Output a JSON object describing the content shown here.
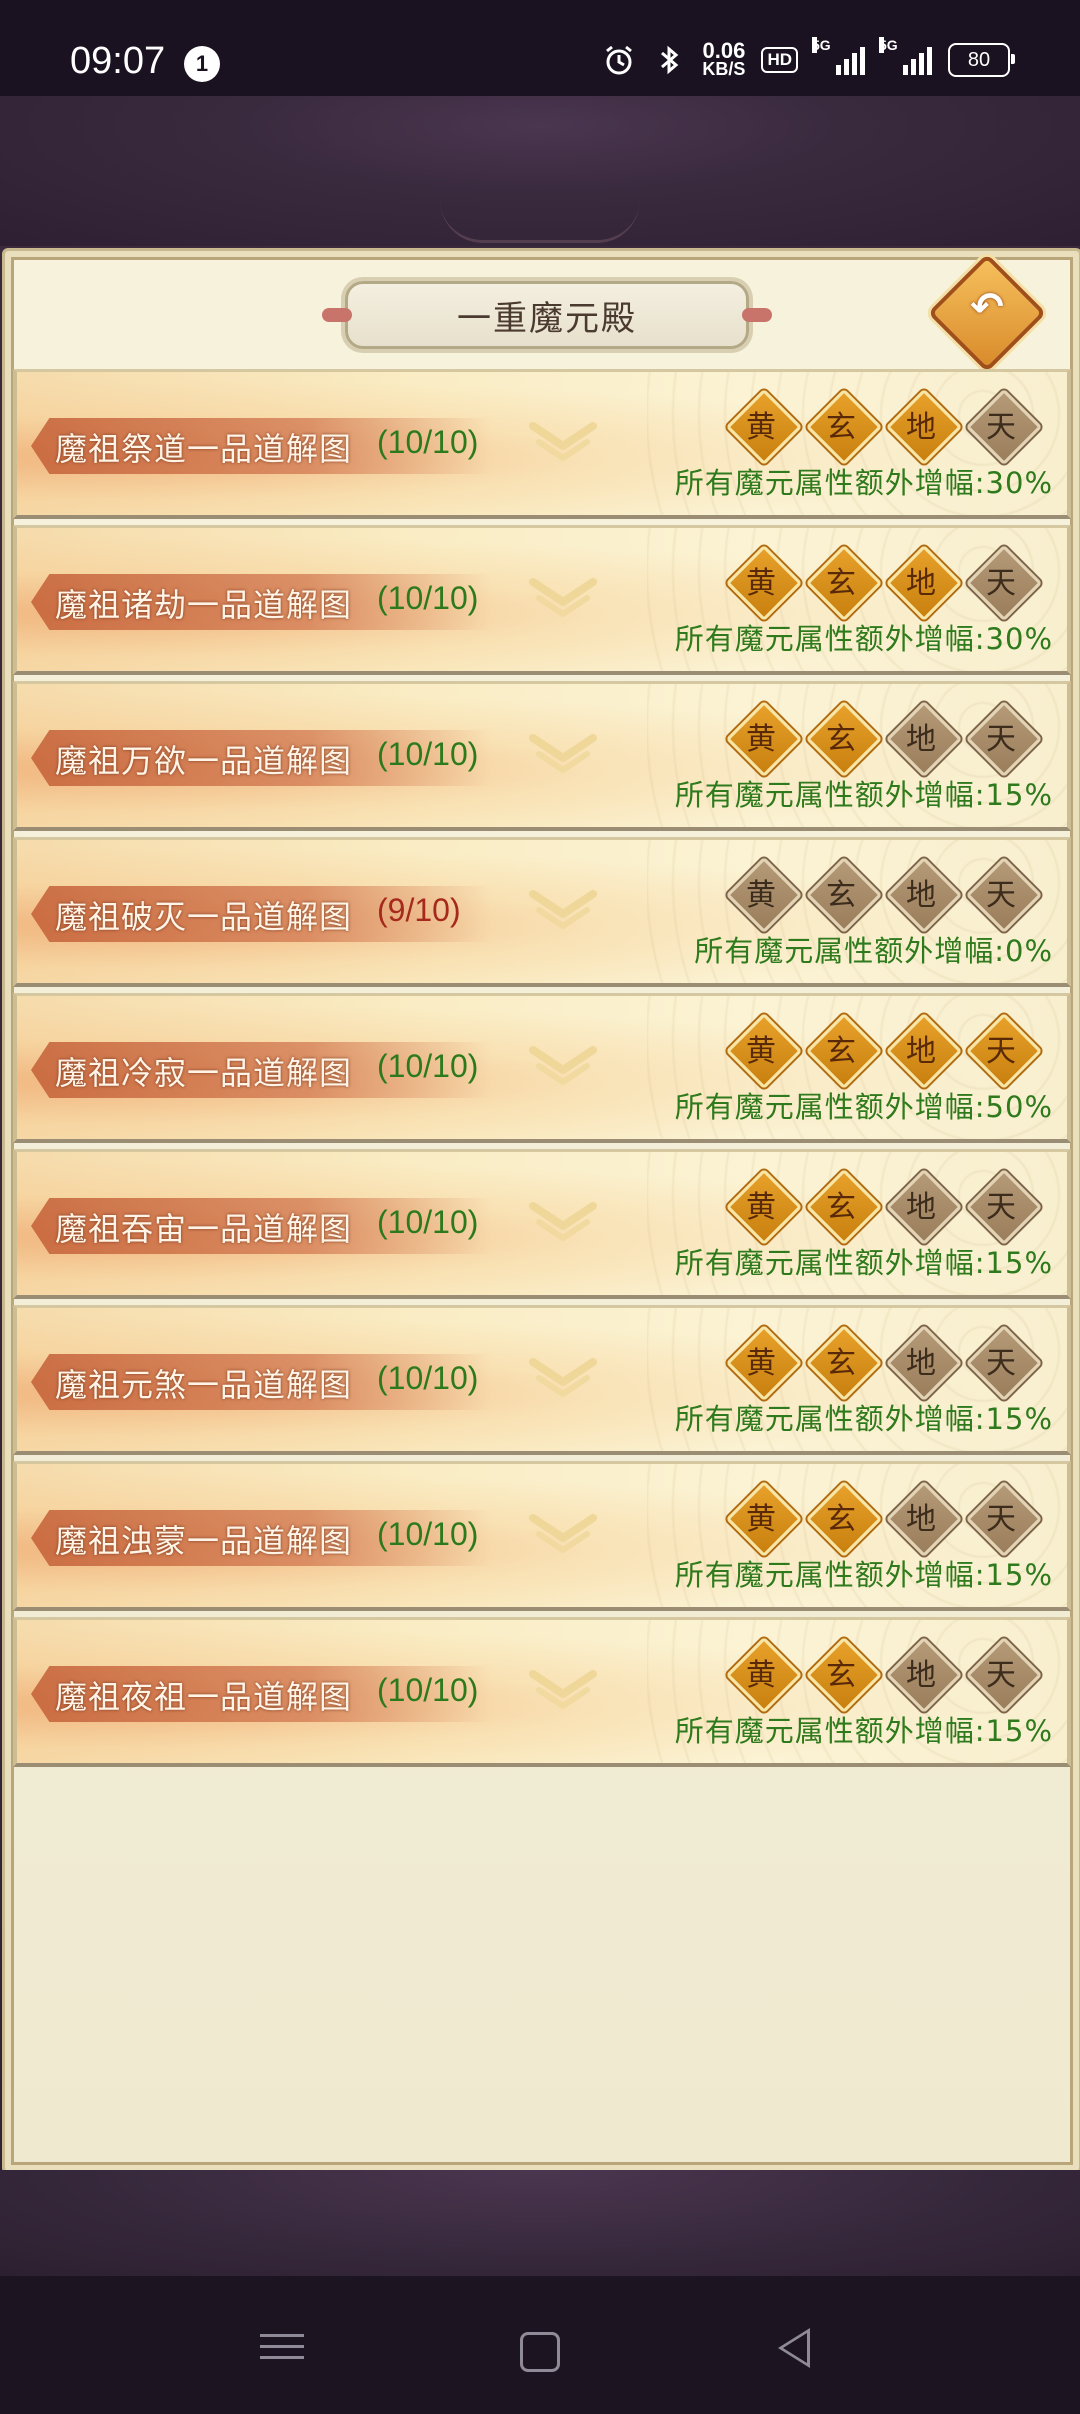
{
  "status_bar": {
    "time": "09:07",
    "notification_count": "1",
    "net_speed_value": "0.06",
    "net_speed_unit": "KB/S",
    "hd_label": "HD",
    "signal_1_label": "5G",
    "signal_2_label": "5G",
    "battery_level": "80"
  },
  "panel": {
    "title": "一重魔元殿"
  },
  "badge_labels": [
    "黄",
    "玄",
    "地",
    "天"
  ],
  "rows": [
    {
      "name": "魔祖祭道一品道解图",
      "progress": "(10/10)",
      "complete": true,
      "badges": [
        true,
        true,
        true,
        false
      ],
      "bonus": "所有魔元属性额外增幅:30%"
    },
    {
      "name": "魔祖诸劫一品道解图",
      "progress": "(10/10)",
      "complete": true,
      "badges": [
        true,
        true,
        true,
        false
      ],
      "bonus": "所有魔元属性额外增幅:30%"
    },
    {
      "name": "魔祖万欲一品道解图",
      "progress": "(10/10)",
      "complete": true,
      "badges": [
        true,
        true,
        false,
        false
      ],
      "bonus": "所有魔元属性额外增幅:15%"
    },
    {
      "name": "魔祖破灭一品道解图",
      "progress": "(9/10)",
      "complete": false,
      "badges": [
        false,
        false,
        false,
        false
      ],
      "bonus": "所有魔元属性额外增幅:0%"
    },
    {
      "name": "魔祖冷寂一品道解图",
      "progress": "(10/10)",
      "complete": true,
      "badges": [
        true,
        true,
        true,
        true
      ],
      "bonus": "所有魔元属性额外增幅:50%"
    },
    {
      "name": "魔祖吞宙一品道解图",
      "progress": "(10/10)",
      "complete": true,
      "badges": [
        true,
        true,
        false,
        false
      ],
      "bonus": "所有魔元属性额外增幅:15%"
    },
    {
      "name": "魔祖元煞一品道解图",
      "progress": "(10/10)",
      "complete": true,
      "badges": [
        true,
        true,
        false,
        false
      ],
      "bonus": "所有魔元属性额外增幅:15%"
    },
    {
      "name": "魔祖浊蒙一品道解图",
      "progress": "(10/10)",
      "complete": true,
      "badges": [
        true,
        true,
        false,
        false
      ],
      "bonus": "所有魔元属性额外增幅:15%"
    },
    {
      "name": "魔祖夜祖一品道解图",
      "progress": "(10/10)",
      "complete": true,
      "badges": [
        true,
        true,
        false,
        false
      ],
      "bonus": "所有魔元属性额外增幅:15%"
    }
  ],
  "colors": {
    "complete_text": "#2d7a1c",
    "incomplete_text": "#a52a1c",
    "badge_on": "#d9911c",
    "badge_off": "#a88c6a"
  },
  "icons": {
    "back": "return-arrow-icon",
    "expand": "chevron-down-icon"
  }
}
